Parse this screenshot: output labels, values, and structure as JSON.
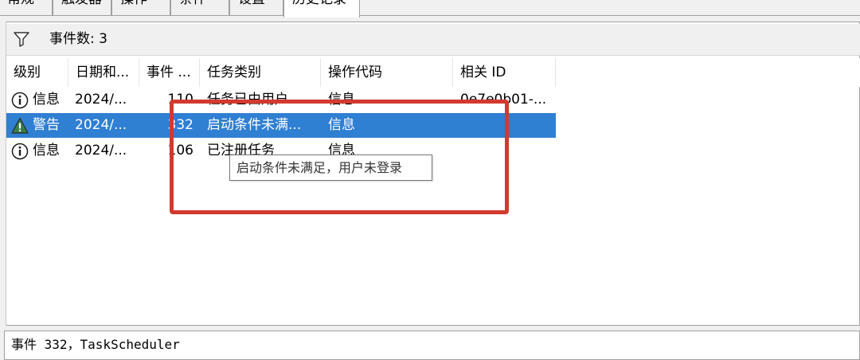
{
  "tabs": [
    {
      "label": "常规",
      "active": false
    },
    {
      "label": "触发器",
      "active": false
    },
    {
      "label": "操作",
      "active": false
    },
    {
      "label": "条件",
      "active": false
    },
    {
      "label": "设置",
      "active": false
    },
    {
      "label": "历史记录",
      "active": true
    }
  ],
  "toolbar": {
    "filter_icon": "filter-funnel-icon",
    "event_count": "事件数: 3"
  },
  "columns": [
    "级别",
    "日期和...",
    "事件 ...",
    "任务类别",
    "操作代码",
    "相关 ID"
  ],
  "rows": [
    {
      "level_icon": "info-icon",
      "level": "信息",
      "date": "2024/...",
      "event": "110",
      "category": "任务已由用户...",
      "opcode": "信息",
      "related_id": "0e7e0b01-...",
      "selected": false
    },
    {
      "level_icon": "warning-icon",
      "level": "警告",
      "date": "2024/...",
      "event": "332",
      "category": "启动条件未满...",
      "opcode": "信息",
      "related_id": "",
      "selected": true
    },
    {
      "level_icon": "info-icon",
      "level": "信息",
      "date": "2024/...",
      "event": "106",
      "category": "已注册任务",
      "opcode": "信息",
      "related_id": "",
      "selected": false
    }
  ],
  "tooltip": "启动条件未满足，用户未登录",
  "status": "事件 332，TaskScheduler",
  "colors": {
    "selection": "#2f7fd3",
    "highlight": "#d23a2e"
  }
}
